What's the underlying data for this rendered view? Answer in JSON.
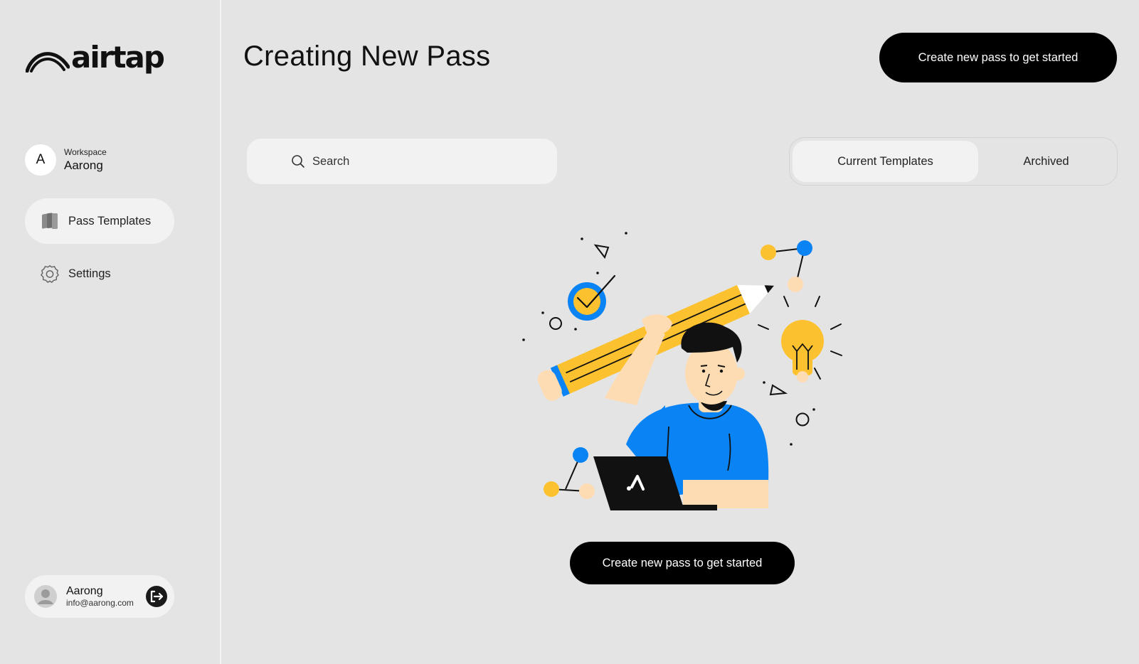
{
  "brand": {
    "name": "airtap",
    "logo_icon": "arc-wings-logo"
  },
  "workspace": {
    "caption": "Workspace",
    "name": "Aarong",
    "initial": "A"
  },
  "sidebar": {
    "items": [
      {
        "label": "Pass Templates",
        "icon": "pass-stack-icon",
        "active": true
      },
      {
        "label": "Settings",
        "icon": "gear-icon",
        "active": false
      }
    ]
  },
  "user": {
    "name": "Aarong",
    "email": "info@aarong.com",
    "avatar_icon": "user-avatar-icon",
    "action_icon": "logout-icon"
  },
  "header": {
    "title": "Creating New Pass",
    "cta_label": "Create new pass to get started"
  },
  "search": {
    "placeholder": "Search",
    "icon": "search-icon"
  },
  "tabs": [
    {
      "label": "Current Templates",
      "selected": true
    },
    {
      "label": "Archived",
      "selected": false
    }
  ],
  "empty_state": {
    "illustration": "person-with-pencil-illustration",
    "cta_label": "Create new pass to get started"
  },
  "colors": {
    "accent_blue": "#0a84f4",
    "accent_yellow": "#fcc12f",
    "button_bg": "#000000",
    "page_bg": "#e4e4e4"
  }
}
